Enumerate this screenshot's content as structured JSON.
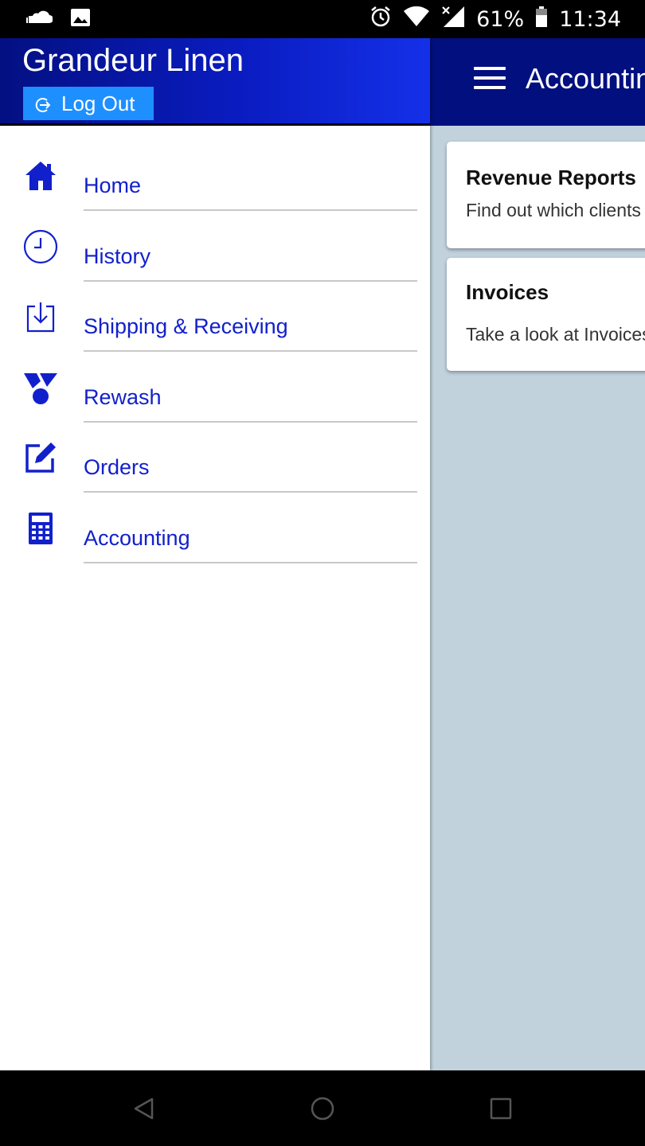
{
  "status_bar": {
    "battery": "61%",
    "time": "11:34",
    "icons": [
      "cloud-icon",
      "image-icon",
      "alarm-icon",
      "wifi-icon",
      "signal-icon",
      "battery-icon"
    ]
  },
  "drawer": {
    "company": "Grandeur Linen",
    "logout_label": "Log Out",
    "items": [
      {
        "label": "Home",
        "icon": "home-icon"
      },
      {
        "label": "History",
        "icon": "clock-icon"
      },
      {
        "label": "Shipping & Receiving",
        "icon": "download-box-icon"
      },
      {
        "label": "Rewash",
        "icon": "rewash-icon"
      },
      {
        "label": "Orders",
        "icon": "edit-icon"
      },
      {
        "label": "Accounting",
        "icon": "calculator-icon"
      }
    ]
  },
  "app_bar": {
    "title": "Accounting"
  },
  "cards": [
    {
      "title": "Revenue Reports",
      "description": "Find out which clients"
    },
    {
      "title": "Invoices",
      "description": "Take a look at Invoices"
    }
  ],
  "colors": {
    "accent_blue": "#1220cc",
    "header_dark": "#020f7e",
    "logout_button": "#1e8fff",
    "content_bg": "#c1d2dd"
  }
}
